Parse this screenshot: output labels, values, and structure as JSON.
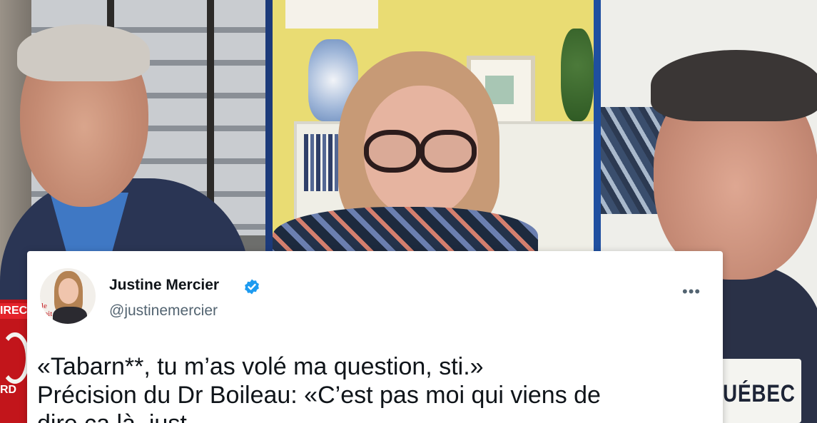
{
  "broadcast": {
    "left_badge_text": "IREC",
    "left_rd_text": "RD",
    "right_tag_text": "UÉBEC"
  },
  "tweet": {
    "author_name": "Justine Mercier",
    "author_handle": "@justinemercier",
    "verified_icon": "verified-badge-icon",
    "avatar_logo_text": "le\nroit",
    "more_icon": "•••",
    "text_line_1": "«Tabarn**, tu m’as volé ma question, sti.»",
    "text_line_2": "Précision du Dr Boileau: «C’est pas moi qui viens de",
    "text_line_3": "dire ça là, just..."
  },
  "colors": {
    "accent_blue": "#1d9bf0",
    "broadcast_red": "#c2151b",
    "panel_divider": "#1f4fa0"
  }
}
